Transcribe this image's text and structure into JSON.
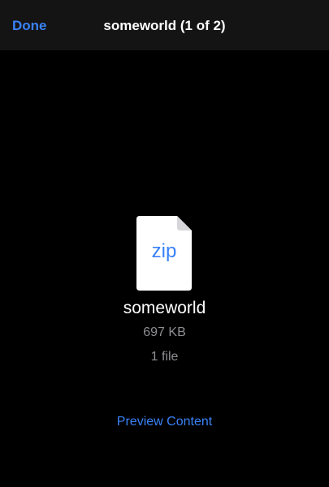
{
  "navbar": {
    "done_label": "Done",
    "title": "someworld (1 of 2)"
  },
  "file": {
    "icon": "zip-file-icon",
    "type_label": "zip",
    "name": "someworld",
    "size": "697 KB",
    "count": "1 file"
  },
  "actions": {
    "preview_label": "Preview Content"
  },
  "colors": {
    "accent": "#3a82f7",
    "background": "#000000",
    "navbar": "#141414",
    "secondary_text": "#8e8e93"
  }
}
